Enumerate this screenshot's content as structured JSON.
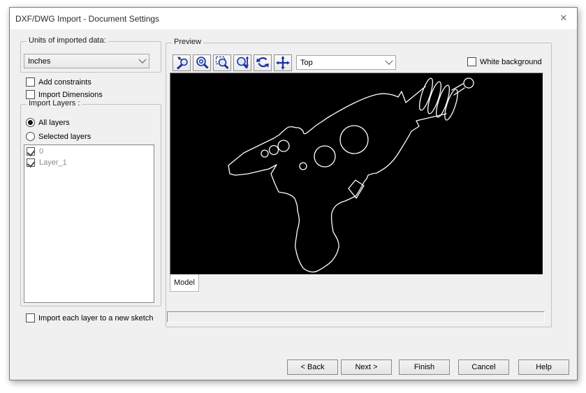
{
  "window": {
    "title": "DXF/DWG Import - Document Settings",
    "close_glyph": "✕"
  },
  "left": {
    "units_group_label": "Units of imported data:",
    "units_value": "Inches",
    "add_constraints_label": "Add constraints",
    "add_constraints_checked": false,
    "import_dimensions_label": "Import Dimensions",
    "import_dimensions_checked": false,
    "layers_group_label": "Import Layers :",
    "all_layers_label": "All layers",
    "all_layers_selected": true,
    "selected_layers_label": "Selected layers",
    "selected_layers_selected": false,
    "layers": [
      {
        "label": "0",
        "checked": true
      },
      {
        "label": "Layer_1",
        "checked": true
      }
    ],
    "import_each_layer_label": "Import each layer to a new sketch",
    "import_each_layer_checked": false
  },
  "preview": {
    "group_label": "Preview",
    "toolbar_icons": [
      "zoom-to-selection-icon",
      "zoom-to-fit-icon",
      "zoom-to-area-icon",
      "zoom-in-out-icon",
      "rotate-view-icon",
      "pan-icon"
    ],
    "view_orientation": "Top",
    "white_background_label": "White background",
    "white_background_checked": false,
    "tab_label": "Model"
  },
  "footer": {
    "buttons": [
      {
        "label": "< Back"
      },
      {
        "label": "Next >"
      },
      {
        "label": "Finish"
      },
      {
        "label": "Cancel"
      },
      {
        "label": "Help"
      }
    ]
  },
  "colors": {
    "dialog_bg": "#f0f0f0",
    "titlebar_bg": "#ffffff",
    "canvas_bg": "#000000",
    "outline": "#ffffff",
    "icon_blue": "#1a2f9e",
    "disabled_text": "#8b8b8b"
  }
}
